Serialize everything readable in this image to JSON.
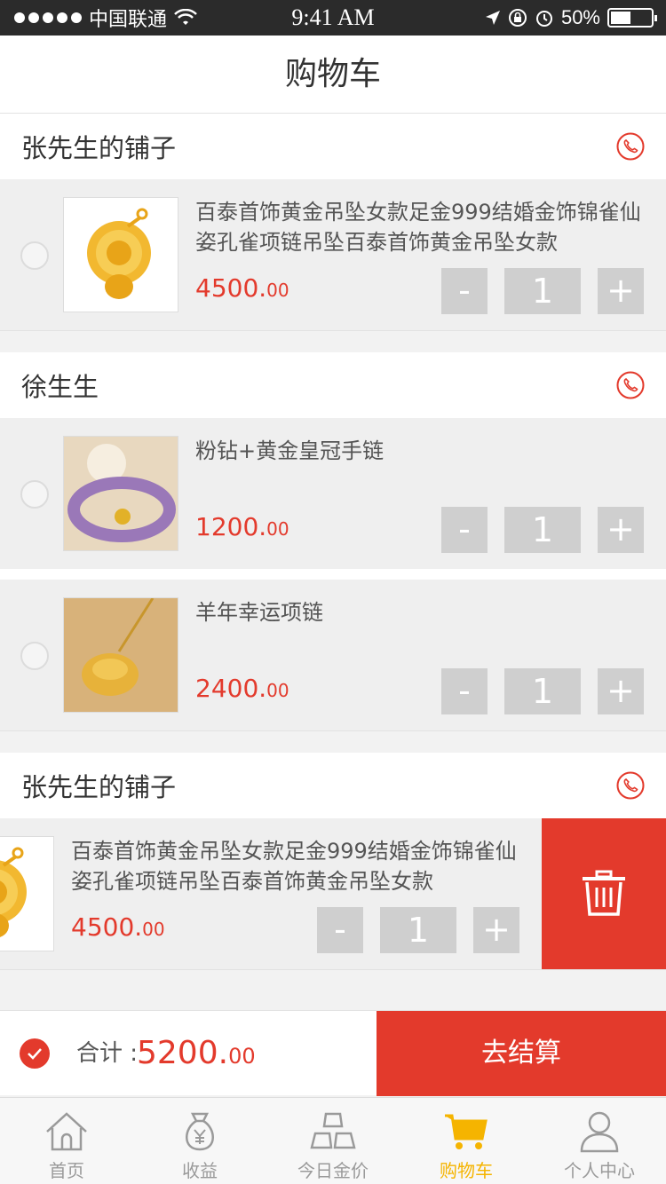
{
  "status_bar": {
    "carrier": "中国联通",
    "time": "9:41 AM",
    "battery": "50%"
  },
  "nav": {
    "title": "购物车"
  },
  "shops": [
    {
      "name": "张先生的铺子",
      "items": [
        {
          "title": "百泰首饰黄金吊坠女款足金999结婚金饰锦雀仙姿孔雀项链吊坠百泰首饰黄金吊坠女款",
          "price_int": "4500.",
          "price_dec": "00",
          "qty": "1"
        }
      ]
    },
    {
      "name": "徐生生",
      "items": [
        {
          "title": "粉钻+黄金皇冠手链",
          "price_int": "1200.",
          "price_dec": "00",
          "qty": "1"
        },
        {
          "title": "羊年幸运项链",
          "price_int": "2400.",
          "price_dec": "00",
          "qty": "1"
        }
      ]
    },
    {
      "name": "张先生的铺子",
      "items": [
        {
          "title": "百泰首饰黄金吊坠女款足金999结婚金饰锦雀仙姿孔雀项链吊坠百泰首饰黄金吊坠女款",
          "price_int": "4500.",
          "price_dec": "00",
          "qty": "1"
        }
      ]
    }
  ],
  "qty_minus": "-",
  "qty_plus": "+",
  "checkout": {
    "total_label": "合计 :",
    "total_int": "5200.",
    "total_dec": "00",
    "pay_label": "去结算"
  },
  "tabs": [
    {
      "label": "首页",
      "icon": "home-icon"
    },
    {
      "label": "收益",
      "icon": "money-bag-icon"
    },
    {
      "label": "今日金价",
      "icon": "gold-bars-icon"
    },
    {
      "label": "购物车",
      "icon": "cart-icon"
    },
    {
      "label": "个人中心",
      "icon": "person-icon"
    }
  ],
  "colors": {
    "accent": "#e33a2c",
    "tab_active": "#f5b400",
    "tab_inactive": "#9a9a9a"
  }
}
